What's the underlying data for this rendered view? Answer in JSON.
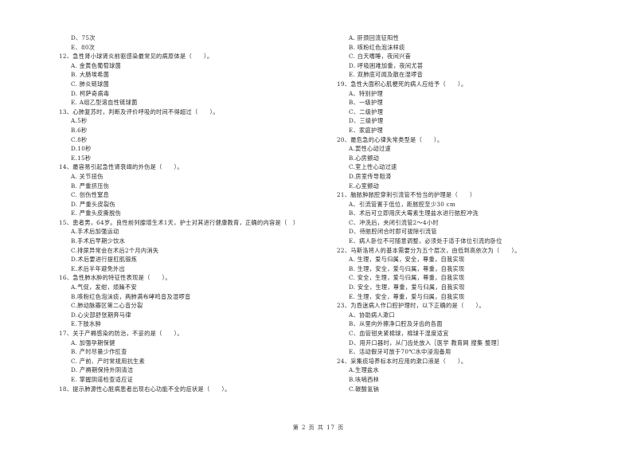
{
  "left_column": [
    {
      "type": "opt",
      "text": "D、75次"
    },
    {
      "type": "opt",
      "text": "E、80次"
    },
    {
      "type": "q",
      "text": "12、急性肾小球肾炎前驱感染最常见的病原体是（　　）。"
    },
    {
      "type": "opt",
      "text": "A. 金黄色葡萄球菌"
    },
    {
      "type": "opt",
      "text": "B. 大肠埃希菌"
    },
    {
      "type": "opt",
      "text": "C. 肺炎链球菌"
    },
    {
      "type": "opt",
      "text": "D. 柯萨奇病毒"
    },
    {
      "type": "opt",
      "text": "E. A组乙型溶血性链球菌"
    },
    {
      "type": "q",
      "text": "13、心肺复苏时，判断及评价呼吸的时间不得超过（　　）。"
    },
    {
      "type": "opt",
      "text": "A.5秒"
    },
    {
      "type": "opt",
      "text": "B.6秒"
    },
    {
      "type": "opt",
      "text": "C.8秒"
    },
    {
      "type": "opt",
      "text": "D.10秒"
    },
    {
      "type": "opt",
      "text": "E.15秒"
    },
    {
      "type": "q",
      "text": "14、最容易引起急性肾衰竭的外伤是（　　）。"
    },
    {
      "type": "opt",
      "text": "A. 关节扭伤"
    },
    {
      "type": "opt",
      "text": "B. 严重挤压伤"
    },
    {
      "type": "opt",
      "text": "C. 创伤性窒息"
    },
    {
      "type": "opt",
      "text": "D. 严重头皮裂伤"
    },
    {
      "type": "opt",
      "text": "E. 严重头皮撕脱伤"
    },
    {
      "type": "q",
      "text": "15、患者男，64岁。良性前列腺增生术1天，护士对其进行健康教育，正确的内容是（　）"
    },
    {
      "type": "opt",
      "text": "A.手术后加强运动"
    },
    {
      "type": "opt",
      "text": "B.手术后早期少饮水"
    },
    {
      "type": "opt",
      "text": "C.排尿异常会在术后2个月内消失"
    },
    {
      "type": "opt",
      "text": "D.术后要进行提肛肌锻炼"
    },
    {
      "type": "opt",
      "text": "E.术后半年避免外出"
    },
    {
      "type": "q",
      "text": "16、急性肺水肿的特征性表现是（　　）。"
    },
    {
      "type": "opt",
      "text": "A.气促，发绀，烦躁不安"
    },
    {
      "type": "opt",
      "text": "B.咳粉红色泡沫痰，两肺满布哮鸣音及湿啰音"
    },
    {
      "type": "opt",
      "text": "C.肺动脉瓣区第二心音分裂"
    },
    {
      "type": "opt",
      "text": "D.心尖部舒张期奔马律"
    },
    {
      "type": "opt",
      "text": "E.下肢水肿"
    },
    {
      "type": "q",
      "text": "17、关于产褥感染的防治，不妥的是（　　）。"
    },
    {
      "type": "opt",
      "text": "A. 加强孕期保健"
    },
    {
      "type": "opt",
      "text": "B. 产时尽量少作肛查"
    },
    {
      "type": "opt",
      "text": "C. 产前、产时常规用抗生素"
    },
    {
      "type": "opt",
      "text": "D. 产褥期保持外阴清洁"
    },
    {
      "type": "opt",
      "text": "E. 掌握阴道检查适应证"
    },
    {
      "type": "q",
      "text": "18、提示肺源性心脏病患者出现右心功能不全的症状是（　　）。"
    }
  ],
  "right_column": [
    {
      "type": "opt",
      "text": "A. 肝颈回流征阳性"
    },
    {
      "type": "opt",
      "text": "B. 咳粉红色泡沫样痰"
    },
    {
      "type": "opt",
      "text": "C. 白天嗜睡，夜间兴奋"
    },
    {
      "type": "opt",
      "text": "D. 呼吸困难加重，夜间尤甚"
    },
    {
      "type": "opt",
      "text": "E. 双肺底可闻及散在湿啰音"
    },
    {
      "type": "q",
      "text": "19、急性大面积心肌梗死的病人应给予（　　）。"
    },
    {
      "type": "opt",
      "text": "A、特别护理"
    },
    {
      "type": "opt",
      "text": "B、一级护理"
    },
    {
      "type": "opt",
      "text": "C、二级护理"
    },
    {
      "type": "opt",
      "text": "D、三级护理"
    },
    {
      "type": "opt",
      "text": "E、家庭护理"
    },
    {
      "type": "q",
      "text": "20、最危急的心律失常类型是（　　）。"
    },
    {
      "type": "opt",
      "text": "A.窦性心动过速"
    },
    {
      "type": "opt",
      "text": "B.心房颤动"
    },
    {
      "type": "opt",
      "text": "C.室上性心动过速"
    },
    {
      "type": "opt",
      "text": "D.房室传导阻滞"
    },
    {
      "type": "opt",
      "text": "E.心室颤动"
    },
    {
      "type": "q",
      "text": "21、脑脓肿脓腔穿刺引流管不恰当的护理是（　　）"
    },
    {
      "type": "opt",
      "text": "A、引流管置于低位，距脓腔至少30 cm"
    },
    {
      "type": "opt",
      "text": "B、术后可立即用庆大霉素生理盐水进行脓腔冲洗"
    },
    {
      "type": "opt",
      "text": "C、冲洗后，夹闭引流管2～4小时"
    },
    {
      "type": "opt",
      "text": "D、待脓腔闭合时即可拔除引流管"
    },
    {
      "type": "opt",
      "text": "E、病人卧位不可随意调整，必须处于适于体位引流的卧位"
    },
    {
      "type": "q",
      "text": "22、马斯洛将人的基本需要分为五个层次，由低到高依次为（　　）。"
    },
    {
      "type": "opt",
      "text": "A. 生理，爱与归属，安全，尊重，自我实现"
    },
    {
      "type": "opt",
      "text": "B. 生理，安全，爱与归属，尊重，自我实现"
    },
    {
      "type": "opt",
      "text": "C. 安全，生理，爱与归属，尊重，自我实现"
    },
    {
      "type": "opt",
      "text": "D. 安全，生理，尊重，爱与归属，自我实现"
    },
    {
      "type": "opt",
      "text": "E. 生理，安全，尊重，爱与归属，自我实现"
    },
    {
      "type": "q",
      "text": "23、为昏迷病人作口腔护理时，以下正确的是（　　）。"
    },
    {
      "type": "opt",
      "text": "A、协助病人漱口"
    },
    {
      "type": "opt",
      "text": "B、从里向外擦净口腔及牙齿的各面"
    },
    {
      "type": "opt",
      "text": "C、血管钳夹紧棉球，棉球干湿度适宜"
    },
    {
      "type": "opt",
      "text": "D、用开口器时，从门齿处放入［医学 教育网 搜集 整理］"
    },
    {
      "type": "opt",
      "text": "E、活动假牙可放于70℃水中浸泡备用"
    },
    {
      "type": "q",
      "text": "24、采集痰培养标本时应用的漱口液是（　　）。"
    },
    {
      "type": "opt",
      "text": "A.生理盐水"
    },
    {
      "type": "opt",
      "text": "B.呋喃西林"
    },
    {
      "type": "opt",
      "text": "C.碳酸氢钠"
    }
  ],
  "footer": {
    "page_label": "第 2 页 共 17 页"
  }
}
